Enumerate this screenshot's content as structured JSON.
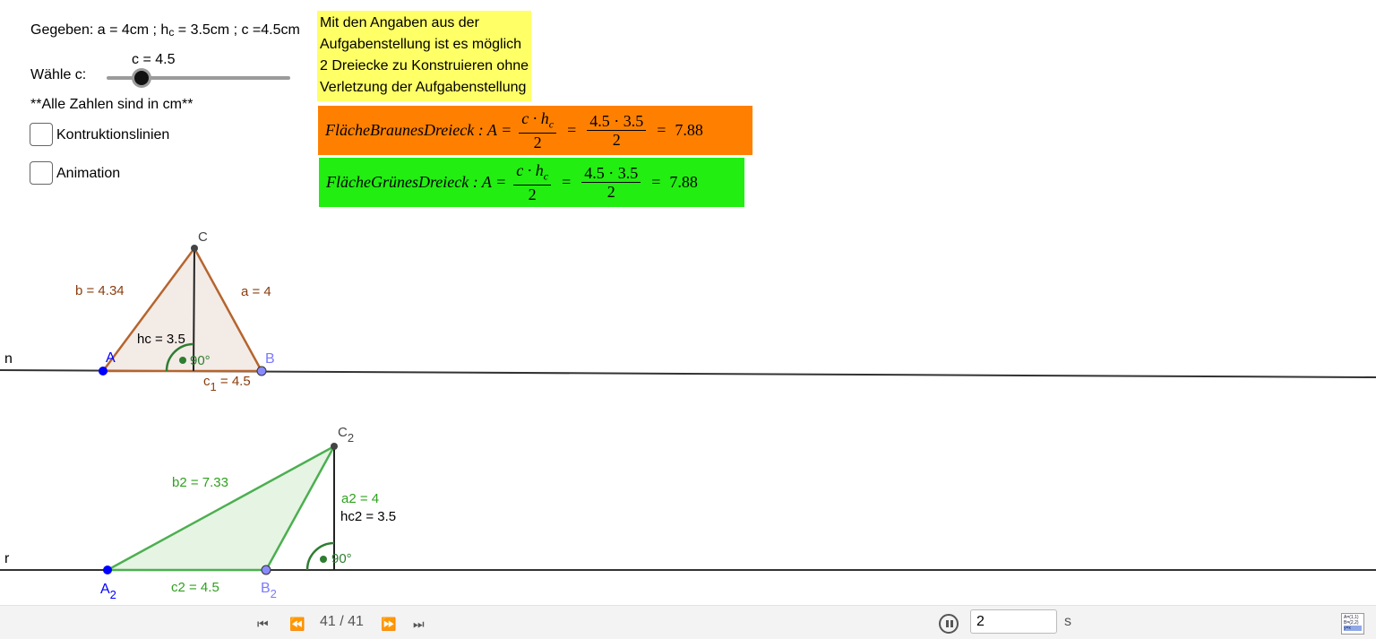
{
  "given": {
    "prefix": "Gegeben: a = 4cm ; h",
    "sub": "c",
    "suffix": " = 3.5cm ; c =4.5cm"
  },
  "slider": {
    "value_label": "c = 4.5",
    "label": "Wähle c:"
  },
  "note": "**Alle Zahlen sind in cm**",
  "checkboxes": {
    "construction": "Kontruktionslinien",
    "animation": "Animation"
  },
  "info_lines": [
    "Mit den Angaben aus der",
    "Aufgabenstellung ist es möglich",
    "2 Dreiecke zu Konstruieren ohne",
    "Verletzung der Aufgabenstellung"
  ],
  "formula_brown": {
    "label": "FlächeBraunesDreieck : A =",
    "num1": "c · h",
    "num1_sub": "c",
    "den": "2",
    "num2": "4.5 · 3.5",
    "result": "7.88"
  },
  "formula_green": {
    "label": "FlächeGrünesDreieck : A =",
    "num1": "c · h",
    "num1_sub": "c",
    "den": "2",
    "num2": "4.5 · 3.5",
    "result": "7.88"
  },
  "triangle1": {
    "C": "C",
    "A": "A",
    "B": "B",
    "b": "b = 4.34",
    "a": "a = 4",
    "hc": "hc = 3.5",
    "angle": "90°",
    "c1": "c",
    "c1_sub": "1",
    "c1_val": " = 4.5",
    "line": "n"
  },
  "triangle2": {
    "C": "C",
    "C_sub": "2",
    "A": "A",
    "A_sub": "2",
    "B": "B",
    "B_sub": "2",
    "b2": "b2 = 7.33",
    "a2": "a2 = 4",
    "hc2": "hc2 = 3.5",
    "angle": "90°",
    "c2": "c2 = 4.5",
    "line": "r"
  },
  "footer": {
    "counter": "41 / 41",
    "speed": "2",
    "speed_unit": "s",
    "first": "⏮",
    "prev": "⏪",
    "next": "⏩",
    "last": "⏭"
  },
  "algebra_icon": {
    "line1": "A=(1,1)",
    "line2": "B=(2,2)",
    "line3": "y=x"
  },
  "colors": {
    "brown": "#8b3e0e",
    "green": "#2fa11f",
    "blue": "#0000ff",
    "light_blue": "#7a7aff",
    "orange": "#ff8000",
    "bright_green": "#22ee11",
    "yellow": "#ffff66"
  }
}
